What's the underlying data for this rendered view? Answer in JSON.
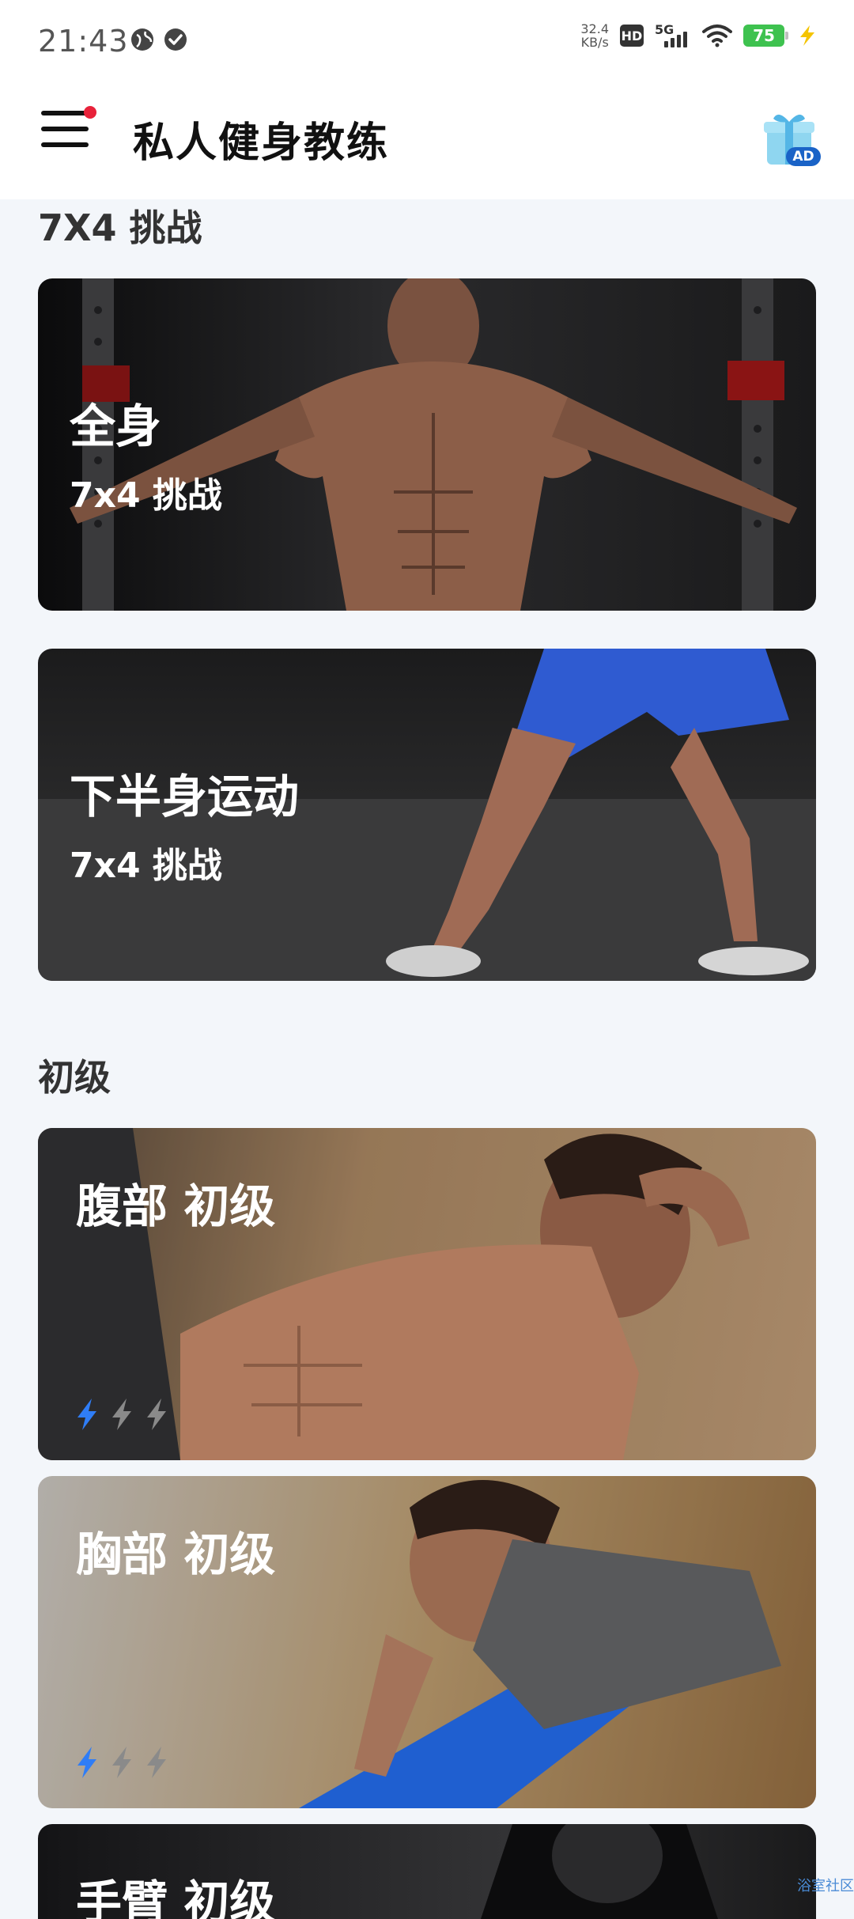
{
  "status_bar": {
    "time": "21:43",
    "speed_value": "32.4",
    "speed_unit": "KB/s",
    "hd_label": "HD",
    "network_label": "5G",
    "battery_level": "75"
  },
  "app_bar": {
    "title": "私人健身教练",
    "ad_badge": "AD"
  },
  "sections": {
    "challenge": {
      "heading": "7X4 挑战",
      "cards": [
        {
          "title": "全身",
          "subtitle": "7x4 挑战"
        },
        {
          "title": "下半身运动",
          "subtitle": "7x4 挑战"
        }
      ]
    },
    "beginner": {
      "heading": "初级",
      "cards": [
        {
          "title": "腹部 初级",
          "difficulty": 1,
          "difficulty_max": 3
        },
        {
          "title": "胸部 初级",
          "difficulty": 1,
          "difficulty_max": 3
        },
        {
          "title": "手臂 初级"
        }
      ]
    }
  },
  "colors": {
    "accent_blue": "#2f7df6",
    "notification_red": "#e8223a",
    "battery_green": "#3ec24f",
    "page_background": "#f3f6fa"
  },
  "watermark": "浴室社区"
}
